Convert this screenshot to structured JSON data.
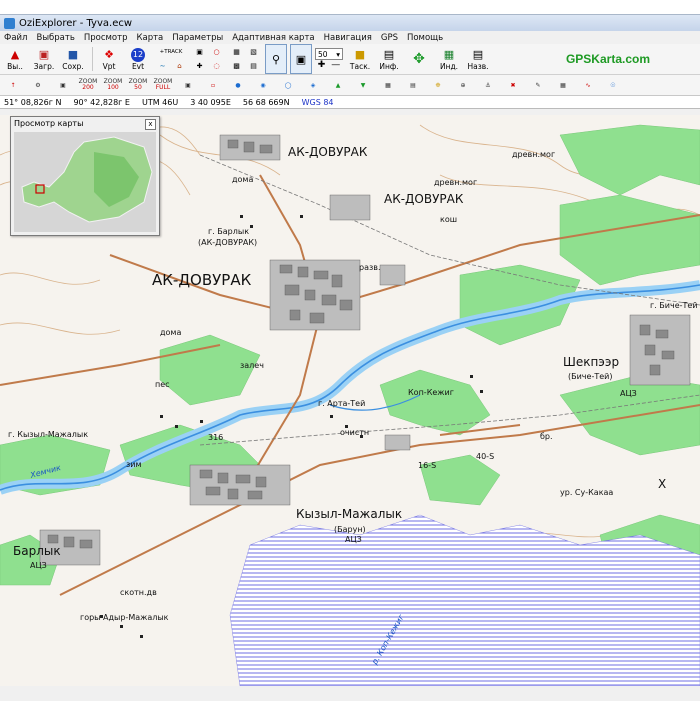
{
  "window": {
    "title": "OziExplorer - Tyva.ecw"
  },
  "menu": [
    "Файл",
    "Выбрать",
    "Просмотр",
    "Карта",
    "Параметры",
    "Адаптивная карта",
    "Навигация",
    "GPS",
    "Помощь"
  ],
  "toolbar": {
    "load_label": "Вы..",
    "open_label": "Загр.",
    "save_label": "Сохр.",
    "vpt_label": "Vpt",
    "evt_label": "Evt",
    "trk_label": "+TRACK",
    "zoom_value": "50",
    "task_label": "Таск.",
    "info_label": "Инф.",
    "index_label": "Инд.",
    "names_label": "Назв.",
    "brand": "GPSKarta.com"
  },
  "toolbar2": {
    "zoom200": "200",
    "zoom100": "100",
    "zoom50": "50",
    "zoomfull": "FULL",
    "zoom_word": "ZOOM"
  },
  "status": {
    "lat": "51° 08,826г N",
    "lon": "90° 42,828г E",
    "utm": "UTM  46U",
    "easting": "3 40 095E",
    "northing": "56 68 669N",
    "datum": "WGS 84"
  },
  "overview": {
    "title": "Просмотр карты",
    "close": "x"
  },
  "map_labels": {
    "ak_dovurak_big": "АК-ДОВУРАК",
    "ak_dovurak_top": "АК-ДОВУРАК",
    "ak_dovurak_mid": "АК-ДОВУРАК",
    "barlyk_g": "г. Барлык",
    "barlyk_ak": "(АК-ДОВУРАК)",
    "shekpeer": "Шекпээр",
    "biche_tei_paren": "(Биче-Тей)",
    "biche_tei": "г. Биче-Тей",
    "ats1": "АЦЗ",
    "arta_tei": "г. Арта-Тей",
    "kop_kezhig": "Коп-Кежиг",
    "kyzyl_mazhalyk_g": "г. Кызыл-Мажалык",
    "kyzyl_mazhalyk": "Кызыл-Мажалык",
    "barun": "(Барун)",
    "ats2": "АЦЗ",
    "barlyk": "Барлык",
    "ats3": "АЦЗ",
    "adyr_mazhalyk": "горы Адыр-Мажалык",
    "su_kakaa": "ур. Су-Какаа",
    "khemchik": "Хемчик",
    "kop_kezhig_river": "р. Коп-Кежиг",
    "razv": "разв.",
    "doma": "дома",
    "zalech": "залеч",
    "ochistn": "очистн",
    "pes": "пес",
    "drev_mog": "древн.мог",
    "kosh": "кош",
    "num316": "316",
    "num16s": "16-S",
    "num40s": "40-S",
    "br": "бр.",
    "skotn": "скотн.дв",
    "zimn": "зим",
    "x_mark": "Х"
  }
}
